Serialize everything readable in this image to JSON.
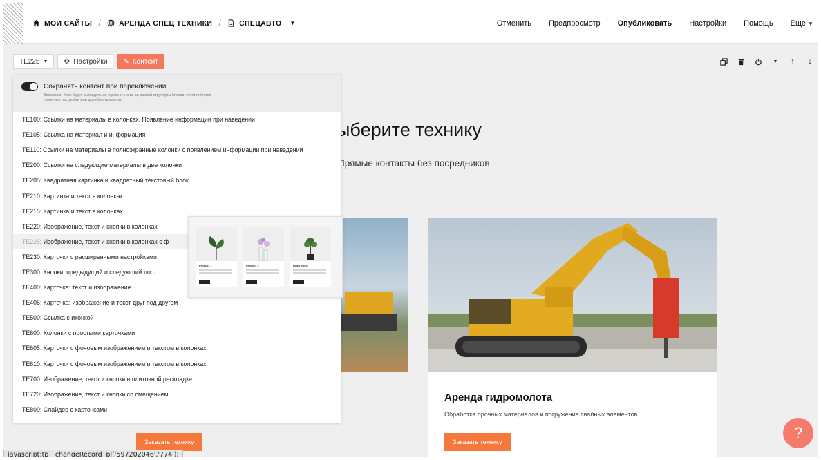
{
  "breadcrumb": {
    "home": "МОИ САЙТЫ",
    "site": "АРЕНДА СПЕЦ ТЕХНИКИ",
    "page": "СПЕЦАВТО"
  },
  "topnav": {
    "cancel": "Отменить",
    "preview": "Предпросмотр",
    "publish": "Опубликовать",
    "settings": "Настройки",
    "help": "Помощь",
    "more": "Еще"
  },
  "toolbar": {
    "block_code": "TE225",
    "settings_label": "Настройки",
    "content_label": "Контент"
  },
  "dropdown": {
    "toggle_label": "Сохранять контент при переключении",
    "toggle_note": "Возможно, блок будет выглядеть не гармонично из-за разной структуры блоков, и потребуется поменять настройки или доработать контент.",
    "items": [
      {
        "code": "TE100",
        "label": ": Ссылки на материалы в колонках. Появление информации при наведении"
      },
      {
        "code": "TE105",
        "label": ": Ссылка на материал и информация"
      },
      {
        "code": "TE110",
        "label": ": Ссылки на материалы в полноэкранные колонки с появлением информации при наведении"
      },
      {
        "code": "TE200",
        "label": ": Ссылки на следующие материалы в две колонки"
      },
      {
        "code": "TE205",
        "label": ": Квадратная картинка и квадратный текстовый блок"
      },
      {
        "code": "TE210",
        "label": ": Картинка и текст в колонках"
      },
      {
        "code": "TE215",
        "label": ": Картинка и текст в колонках"
      },
      {
        "code": "TE220",
        "label": ": Изображение, текст и кнопки в колонках"
      },
      {
        "code": "TE225",
        "label": ": Изображение, текст и кнопки в колонках с ф"
      },
      {
        "code": "TE230",
        "label": ": Карточки с расширенными настройками"
      },
      {
        "code": "TE300",
        "label": ": Кнопки: предыдущий и следующий пост"
      },
      {
        "code": "TE400",
        "label": ": Карточка: текст и изображение"
      },
      {
        "code": "TE405",
        "label": ": Карточка: изображение и текст друг под другом"
      },
      {
        "code": "TE500",
        "label": ": Ссылка с иконкой"
      },
      {
        "code": "TE600",
        "label": ": Колонки с простыми карточками"
      },
      {
        "code": "TE605",
        "label": ": Карточки с фоновым изображением и текстом в колонках"
      },
      {
        "code": "TE610",
        "label": ": Карточки с фоновым изображением и текстом в колонках"
      },
      {
        "code": "TE700",
        "label": ": Изображение, текст и кнопки в плиточной раскладке"
      },
      {
        "code": "TE720",
        "label": ": Изображение, текст и кнопки со смещением"
      },
      {
        "code": "TE800",
        "label": ": Слайдер с карточками"
      }
    ]
  },
  "preview": {
    "cards": [
      {
        "name": "Product 1"
      },
      {
        "name": "Product 2"
      },
      {
        "name": "Read more"
      }
    ]
  },
  "page": {
    "heading": "ыберите технику",
    "subheading": "Прямые контакты без посредников",
    "card_title": "Аренда гидромолота",
    "card_desc": "Обработка прочных материалов и погружение свайных элементов",
    "order_button": "Заказать технику"
  },
  "help_button": "?",
  "status_bar": "javascript:tp__changeRecordTpl('597202046','774');",
  "colors": {
    "accent": "#f5775c",
    "order_button": "#f5793d",
    "help_button": "#f47c6b"
  }
}
